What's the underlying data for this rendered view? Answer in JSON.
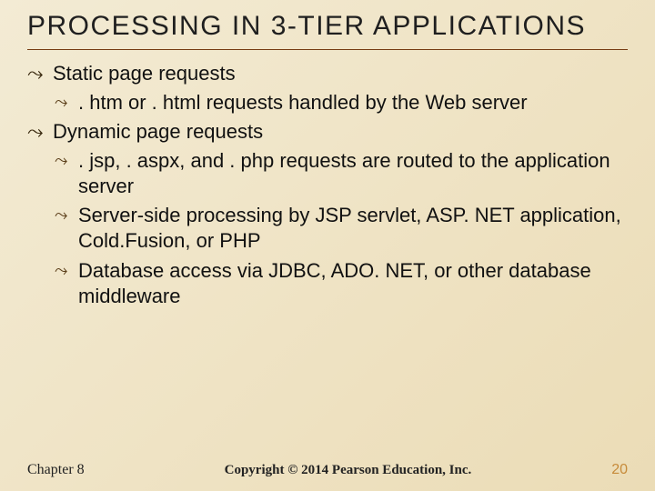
{
  "title": "PROCESSING IN 3-TIER APPLICATIONS",
  "bullets": {
    "b1a": "Static page requests",
    "b1a_1": ". htm or . html requests handled by the Web server",
    "b1b": "Dynamic page requests",
    "b1b_1": ". jsp, . aspx, and . php requests are routed to the application server",
    "b1b_2": "Server-side processing by JSP servlet, ASP. NET application, Cold.Fusion, or PHP",
    "b1b_3": "Database access via JDBC, ADO. NET, or other database middleware"
  },
  "footer": {
    "chapter": "Chapter 8",
    "copyright": "Copyright © 2014 Pearson Education, Inc.",
    "pagenum": "20"
  }
}
